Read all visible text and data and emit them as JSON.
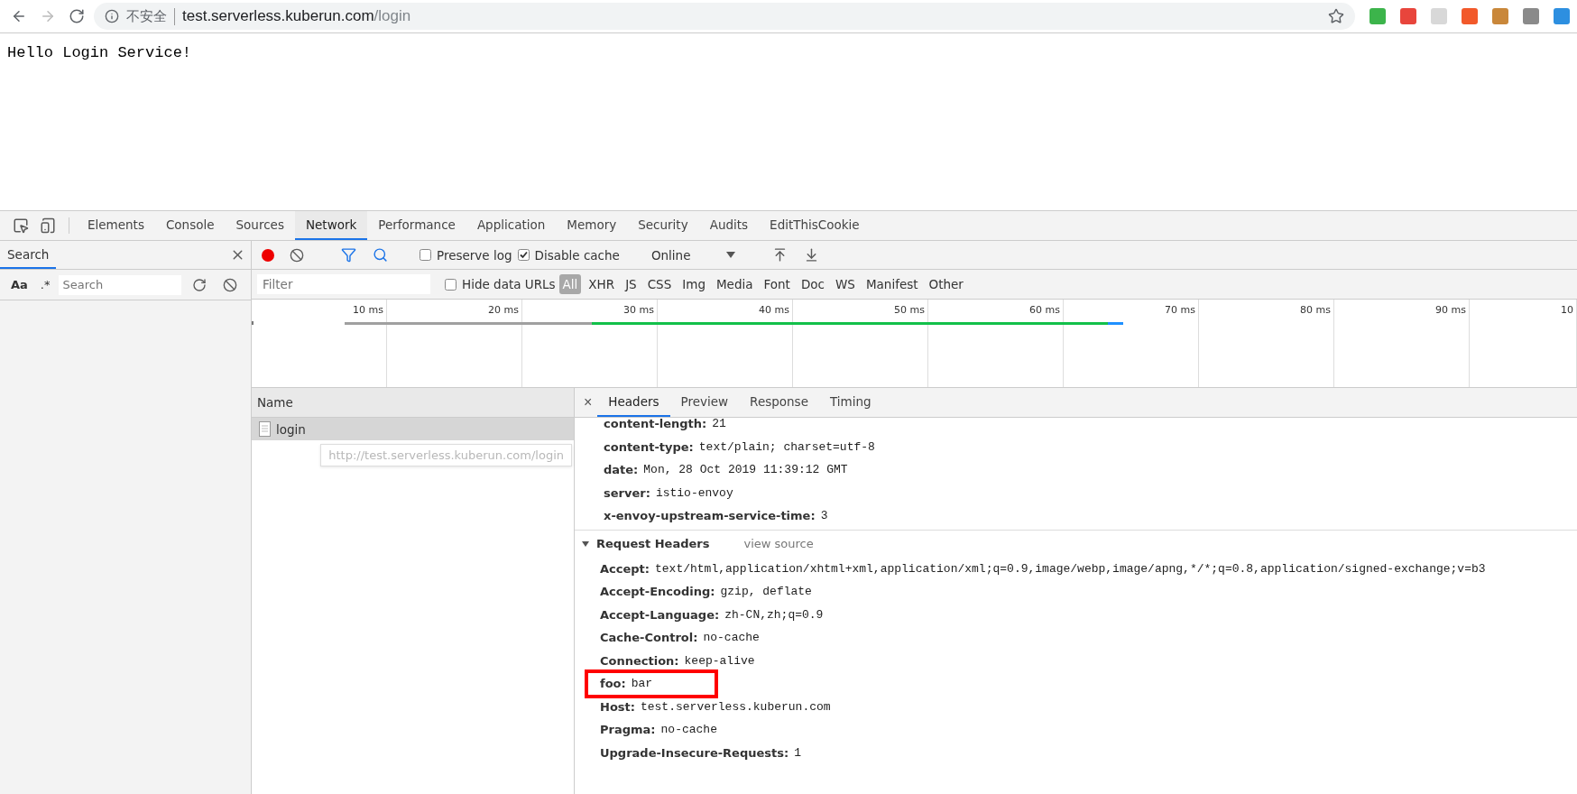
{
  "browser": {
    "security_label": "不安全",
    "url_host": "test.serverless.kuberun.com",
    "url_path": "/login",
    "extensions": [
      {
        "color": "#3cb44b"
      },
      {
        "color": "#e8453c"
      },
      {
        "color": "#d8d8d8"
      },
      {
        "color": "#f2592a"
      },
      {
        "color": "#c9873a"
      },
      {
        "color": "#8a8a8a"
      },
      {
        "color": "#2d8fe0"
      }
    ]
  },
  "page": {
    "text": "Hello Login Service!"
  },
  "devtools": {
    "tabs": [
      {
        "label": "Elements",
        "selected": false
      },
      {
        "label": "Console",
        "selected": false
      },
      {
        "label": "Sources",
        "selected": false
      },
      {
        "label": "Network",
        "selected": true
      },
      {
        "label": "Performance",
        "selected": false
      },
      {
        "label": "Application",
        "selected": false
      },
      {
        "label": "Memory",
        "selected": false
      },
      {
        "label": "Security",
        "selected": false
      },
      {
        "label": "Audits",
        "selected": false
      },
      {
        "label": "EditThisCookie",
        "selected": false
      }
    ],
    "drawer": {
      "title": "Search",
      "case_label": "Aa",
      "regex_label": ".*",
      "search_placeholder": "Search"
    },
    "toolbar": {
      "recording": true,
      "preserve_log": {
        "label": "Preserve log",
        "checked": false
      },
      "disable_cache": {
        "label": "Disable cache",
        "checked": true
      },
      "throttling": "Online"
    },
    "filter": {
      "placeholder": "Filter",
      "hide_data_urls": {
        "label": "Hide data URLs",
        "checked": false
      },
      "types": [
        {
          "label": "All",
          "selected": true
        },
        {
          "label": "XHR",
          "selected": false
        },
        {
          "label": "JS",
          "selected": false
        },
        {
          "label": "CSS",
          "selected": false
        },
        {
          "label": "Img",
          "selected": false
        },
        {
          "label": "Media",
          "selected": false
        },
        {
          "label": "Font",
          "selected": false
        },
        {
          "label": "Doc",
          "selected": false
        },
        {
          "label": "WS",
          "selected": false
        },
        {
          "label": "Manifest",
          "selected": false
        },
        {
          "label": "Other",
          "selected": false
        }
      ]
    },
    "timeline": {
      "ticks": [
        "10 ms",
        "20 ms",
        "30 ms",
        "40 ms",
        "50 ms",
        "60 ms",
        "70 ms",
        "80 ms",
        "90 ms",
        "10"
      ]
    },
    "requests": {
      "column": "Name",
      "rows": [
        {
          "name": "login",
          "selected": true
        }
      ]
    },
    "tooltip": "http://test.serverless.kuberun.com/login",
    "detail": {
      "close": "×",
      "tabs": [
        {
          "label": "Headers",
          "selected": true
        },
        {
          "label": "Preview",
          "selected": false
        },
        {
          "label": "Response",
          "selected": false
        },
        {
          "label": "Timing",
          "selected": false
        }
      ],
      "response_headers": [
        {
          "name": "content-length:",
          "value": "21"
        },
        {
          "name": "content-type:",
          "value": "text/plain; charset=utf-8"
        },
        {
          "name": "date:",
          "value": "Mon, 28 Oct 2019 11:39:12 GMT"
        },
        {
          "name": "server:",
          "value": "istio-envoy"
        },
        {
          "name": "x-envoy-upstream-service-time:",
          "value": "3"
        }
      ],
      "request_headers": {
        "title": "Request Headers",
        "expanded": true,
        "view_source": "view source",
        "rows": [
          {
            "name": "Accept:",
            "value": "text/html,application/xhtml+xml,application/xml;q=0.9,image/webp,image/apng,*/*;q=0.8,application/signed-exchange;v=b3",
            "highlighted": false
          },
          {
            "name": "Accept-Encoding:",
            "value": "gzip, deflate",
            "highlighted": false
          },
          {
            "name": "Accept-Language:",
            "value": "zh-CN,zh;q=0.9",
            "highlighted": false
          },
          {
            "name": "Cache-Control:",
            "value": "no-cache",
            "highlighted": false
          },
          {
            "name": "Connection:",
            "value": "keep-alive",
            "highlighted": false
          },
          {
            "name": "foo:",
            "value": "bar",
            "highlighted": true
          },
          {
            "name": "Host:",
            "value": "test.serverless.kuberun.com",
            "highlighted": false
          },
          {
            "name": "Pragma:",
            "value": "no-cache",
            "highlighted": false
          },
          {
            "name": "Upgrade-Insecure-Requests:",
            "value": "1",
            "highlighted": false
          }
        ]
      }
    }
  }
}
